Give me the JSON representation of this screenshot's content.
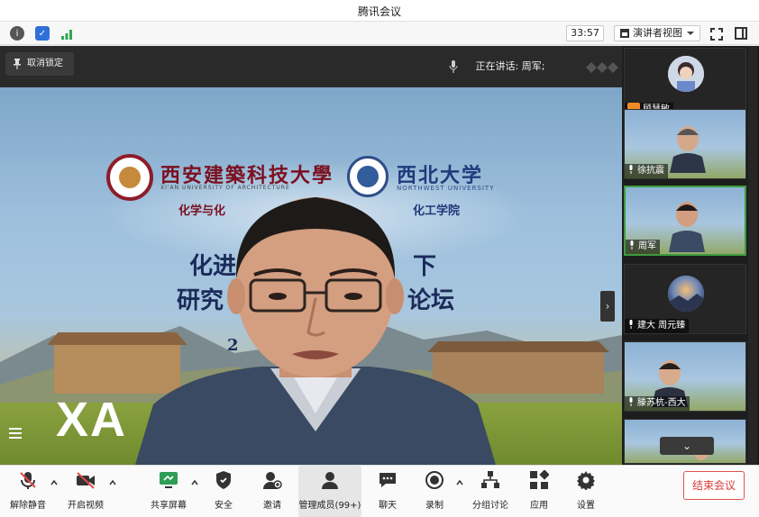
{
  "window": {
    "title": "腾讯会议"
  },
  "infobar": {
    "timer": "33:57",
    "view_mode": "演讲者视图"
  },
  "stage": {
    "unpin_label": "取消锁定",
    "speaking_label": "正在讲话: 周军;",
    "slide": {
      "univ1_cn": "西安建築科技大學",
      "univ1_en": "XI'AN UNIVERSITY OF ARCHITECTURE",
      "univ2_cn": "西北大学",
      "univ2_en": "NORTHWEST UNIVERSITY",
      "dept1": "化学与化",
      "dept2": "化工学院",
      "line1a": "化进",
      "line1b": "下",
      "line2a": "研究",
      "line2b": "论坛",
      "line3": "2",
      "sign": "XA"
    }
  },
  "participants": [
    {
      "name": "顾慧敏",
      "type": "avatar",
      "host": true
    },
    {
      "name": "徐抗震",
      "type": "video"
    },
    {
      "name": "周军",
      "type": "video",
      "active": true
    },
    {
      "name": "建大 周元臻",
      "type": "avatar"
    },
    {
      "name": "滕苏杭-西大",
      "type": "video"
    },
    {
      "name": "",
      "type": "video"
    }
  ],
  "toolbar": {
    "items": [
      {
        "id": "mute",
        "label": "解除静音",
        "icon": "mic-muted-icon"
      },
      {
        "id": "video",
        "label": "开启视频",
        "icon": "camera-off-icon"
      },
      {
        "id": "share",
        "label": "共享屏幕",
        "icon": "share-screen-icon"
      },
      {
        "id": "security",
        "label": "安全",
        "icon": "shield-icon"
      },
      {
        "id": "invite",
        "label": "邀请",
        "icon": "add-user-icon"
      },
      {
        "id": "members",
        "label": "管理成员(99+)",
        "icon": "users-icon"
      },
      {
        "id": "chat",
        "label": "聊天",
        "icon": "chat-icon"
      },
      {
        "id": "record",
        "label": "录制",
        "icon": "record-icon"
      },
      {
        "id": "breakout",
        "label": "分组讨论",
        "icon": "breakout-icon"
      },
      {
        "id": "apps",
        "label": "应用",
        "icon": "apps-icon"
      },
      {
        "id": "settings",
        "label": "设置",
        "icon": "gear-icon"
      }
    ],
    "end_label": "结束会议"
  },
  "colors": {
    "end": "#d93a3a",
    "host": "#f08a24",
    "active_border": "#3d9b3d"
  }
}
